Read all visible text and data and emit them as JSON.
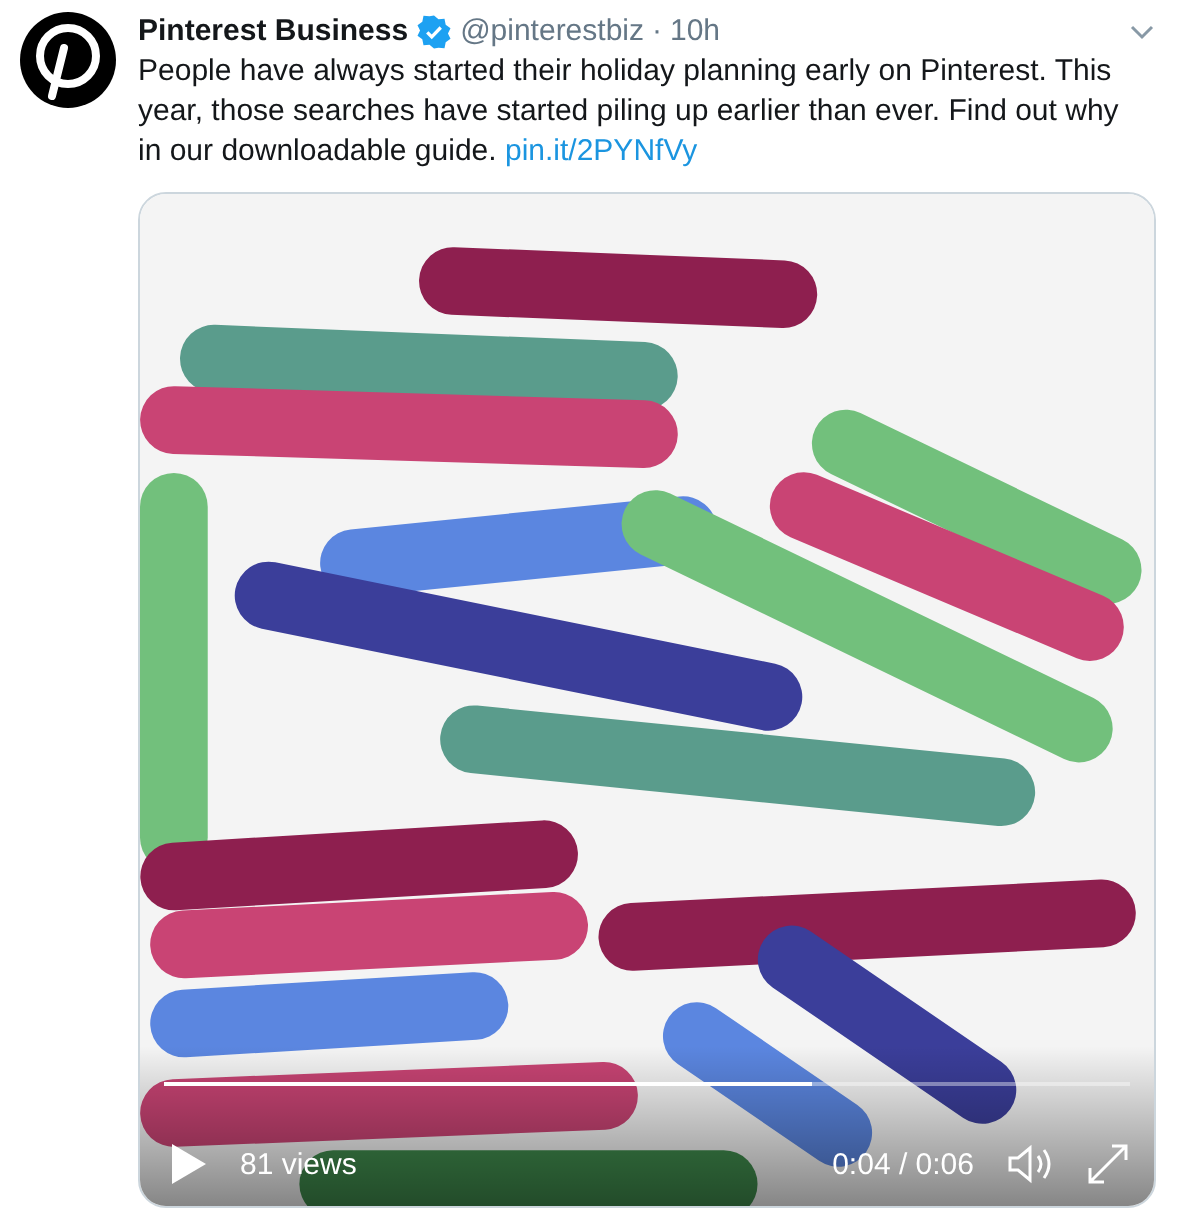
{
  "tweet": {
    "author": "Pinterest Business",
    "verified": true,
    "handle": "@pinterestbiz",
    "separator": "·",
    "time": "10h",
    "text": "People have always started their holiday planning early on Pinterest. This year, those searches have started piling up earlier than ever. Find out why in our downloadable guide.",
    "link": "pin.it/2PYNfVy"
  },
  "video": {
    "kind": "picture",
    "playing": false,
    "views": "81 views",
    "time": "0:04 / 0:06",
    "progress": {
      "level": 0.67
    }
  }
}
